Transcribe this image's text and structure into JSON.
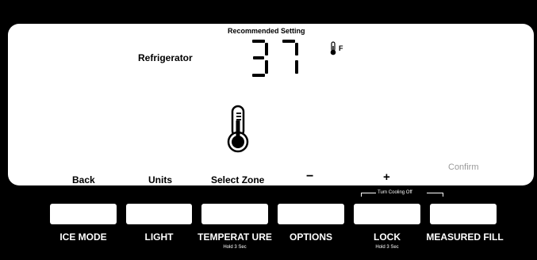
{
  "display": {
    "recommended_label": "Recommended Setting",
    "zone_label": "Refrigerator",
    "temperature": "37",
    "unit": "F",
    "soft_keys": {
      "back": "Back",
      "units": "Units",
      "select_zone": "Select Zone",
      "minus": "−",
      "plus": "+",
      "confirm": "Confirm"
    }
  },
  "controls": {
    "cooling_off_hint": "Turn Cooling Off",
    "buttons": [
      {
        "label": "ICE MODE",
        "sub": ""
      },
      {
        "label": "LIGHT",
        "sub": ""
      },
      {
        "label": "TEMPERAT URE",
        "sub": "Hold 3 Sec"
      },
      {
        "label": "OPTIONS",
        "sub": ""
      },
      {
        "label": "LOCK",
        "sub": "Hold 3 Sec"
      },
      {
        "label": "MEASURED FILL",
        "sub": ""
      }
    ]
  },
  "colors": {
    "background": "#000000",
    "display": "#ffffff",
    "confirm_text": "#9a9a9a"
  },
  "icons": [
    "thermometer-icon",
    "thermometer-large-icon"
  ]
}
